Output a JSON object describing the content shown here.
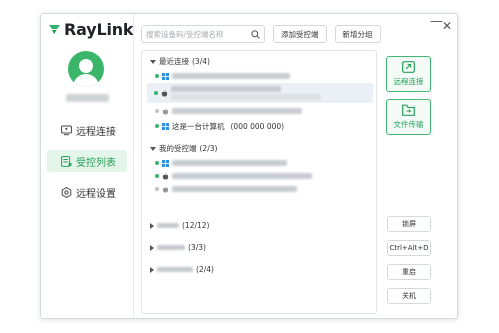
{
  "app": {
    "name": "RayLink"
  },
  "brand": {
    "accent": "#25a05a",
    "online": "#35b66b",
    "offline": "#bfc3c8"
  },
  "sidebar": {
    "items": [
      {
        "label": "远程连接",
        "icon": "monitor-icon",
        "active": false
      },
      {
        "label": "受控列表",
        "icon": "device-list-icon",
        "active": true
      },
      {
        "label": "远程设置",
        "icon": "gear-icon",
        "active": false
      }
    ]
  },
  "toolbar": {
    "search_placeholder": "搜索设备码/受控端名称",
    "add_label": "添加受控端",
    "new_group_label": "新增分组"
  },
  "groups": [
    {
      "name": "最近连接",
      "count": "(3/4)",
      "expanded": true
    },
    {
      "name": "我的受控端",
      "count": "(2/3)",
      "expanded": true
    },
    {
      "name": "",
      "count": "(12/12)",
      "expanded": false
    },
    {
      "name": "",
      "count": "(3/3)",
      "expanded": false
    },
    {
      "name": "",
      "count": "(2/4)",
      "expanded": false
    }
  ],
  "recent_devices": [
    {
      "os": "windows",
      "status": "online"
    },
    {
      "os": "apple",
      "status": "online",
      "selected": true
    },
    {
      "os": "apple",
      "status": "offline"
    },
    {
      "os": "windows",
      "status": "online",
      "name": "这是一台计算机",
      "code": "(000 000 000)"
    }
  ],
  "my_devices": [
    {
      "os": "windows",
      "status": "online"
    },
    {
      "os": "apple",
      "status": "online"
    },
    {
      "os": "apple",
      "status": "offline"
    }
  ],
  "actions": {
    "remote_connect": "远程连接",
    "file_transfer": "文件传输",
    "lock_screen": "锁屏",
    "ctrl_alt_del": "Ctrl+Alt+D",
    "restart": "重启",
    "shutdown": "关机"
  }
}
